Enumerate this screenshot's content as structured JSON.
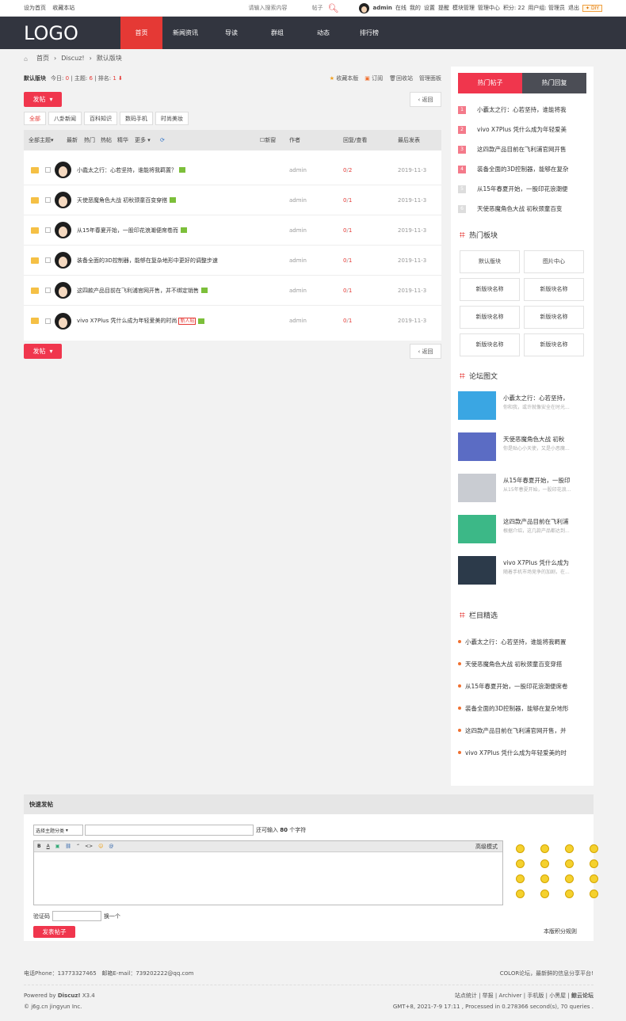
{
  "topbar": {
    "set_home": "设为首页",
    "favorite": "收藏本站",
    "search_placeholder": "请输入搜索内容",
    "search_type": "帖子",
    "user": "admin",
    "links": [
      "在线",
      "我的",
      "设置",
      "提醒",
      "模块管理",
      "管理中心"
    ],
    "points": "积分: 22",
    "group": "用户组: 管理员",
    "logout": "退出",
    "diy": "DIY"
  },
  "nav": {
    "logo": "LOGO",
    "items": [
      "首页",
      "新闻资讯",
      "导读",
      "群组",
      "动态",
      "排行榜"
    ]
  },
  "breadcrumb": [
    "首页",
    "Discuz!",
    "默认版块"
  ],
  "forum": {
    "name": "默认版块",
    "today_label": "今日:",
    "today": "0",
    "topics_label": "主题:",
    "topics": "6",
    "rank_label": "排名:",
    "rank": "1",
    "actions": [
      "收藏本版",
      "订阅",
      "回收站",
      "管理面板"
    ]
  },
  "buttons": {
    "post": "发帖",
    "back": "返回"
  },
  "types": [
    "全部",
    "八卦新闻",
    "百科知识",
    "数码手机",
    "时尚美妆"
  ],
  "thead": {
    "filter": "全部主题",
    "latest": "最新",
    "hot": "热门",
    "hotpost": "热帖",
    "digest": "精华",
    "more": "更多",
    "newwin": "新窗",
    "author": "作者",
    "replies": "回复/查看",
    "lastpost": "最后发表"
  },
  "threads": [
    {
      "title": "小蠹太之行：心若坚持，谁能将我羁置？",
      "author": "admin",
      "reply": "0",
      "view": "2",
      "date": "2019-11-3",
      "new": ""
    },
    {
      "title": "天使恶魔角色大战 初秋颈童百变穿搭",
      "author": "admin",
      "reply": "0",
      "view": "1",
      "date": "2019-11-3",
      "new": ""
    },
    {
      "title": "从15年春夏开始，一股印花浪潮便席卷而",
      "author": "admin",
      "reply": "0",
      "view": "1",
      "date": "2019-11-3",
      "new": ""
    },
    {
      "title": "装备全面的3D控制器，能够在复杂地形中更好的调整步速",
      "author": "admin",
      "reply": "0",
      "view": "1",
      "date": "2019-11-3",
      "new": ""
    },
    {
      "title": "这四款产品目前在飞利浦官网开售，并不绑定销售",
      "author": "admin",
      "reply": "0",
      "view": "1",
      "date": "2019-11-3",
      "new": ""
    },
    {
      "title": "vivo X7Plus 凭什么成为年轻爱美的时尚",
      "author": "admin",
      "reply": "0",
      "view": "1",
      "date": "2019-11-3",
      "new": "新人帖"
    }
  ],
  "side": {
    "tab_hot": "热门帖子",
    "tab_reply": "热门回复",
    "hot": [
      "小蠹太之行：心若坚持，谁能将我",
      "vivo X7Plus 凭什么成为年轻爱美",
      "这四款产品目前在飞利浦官网开售",
      "装备全面的3D控制器，能够在复杂",
      "从15年春夏开始，一股印花浪潮便",
      "天使恶魔角色大战 初秋颈童百变"
    ],
    "hot_nums": [
      "1",
      "2",
      "3",
      "4",
      "5",
      "6"
    ],
    "blocks_title": "热门板块",
    "blocks": [
      "默认版块",
      "图片中心",
      "新版块名称",
      "新版块名称",
      "新版块名称",
      "新版块名称",
      "新版块名称",
      "新版块名称"
    ],
    "pics_title": "论坛图文",
    "pics": [
      {
        "t": "小蠹太之行：心若坚持，",
        "d": "你和我，或许就像安全在时光..."
      },
      {
        "t": "天使恶魔角色大战 初秋",
        "d": "你是贴心小天使，又是小恶魔..."
      },
      {
        "t": "从15年春夏开始，一股印",
        "d": "从15年春夏开始，一股印花浪..."
      },
      {
        "t": "这四款产品目前在飞利浦",
        "d": "根据介绍，这几款产品都达到..."
      },
      {
        "t": "vivo X7Plus 凭什么成为",
        "d": "随着手机市场竞争的加剧，在..."
      }
    ],
    "picks_title": "栏目精选",
    "picks": [
      "小蠹太之行：心若坚持，谁能将我羁置",
      "天使恶魔角色大战 初秋颈童百变穿搭",
      "从15年春夏开始，一股印花浪潮便席卷",
      "装备全面的3D控制器，能够在复杂地形",
      "这四款产品目前在飞利浦官网开售，并",
      "vivo X7Plus 凭什么成为年轻爱美的时"
    ]
  },
  "quick": {
    "title": "快速发帖",
    "category": "选择主题分类",
    "remain": "还可输入",
    "remain_num": "80",
    "remain_unit": "个字符",
    "advanced": "高级模式",
    "captcha": "验证码",
    "change": "换一个",
    "submit": "发表帖子",
    "rules": "本版积分规则"
  },
  "footer": {
    "phone": "电话Phone：13773327465",
    "email": "邮箱E-mail：739202222@qq.com",
    "slogan": "COLOR论坛，最新鲜的信息分享平台!",
    "powered": "Powered by",
    "discuz": "Discuz!",
    "ver": "X3.4",
    "copy": "© j6g.cn jingyun Inc.",
    "links": [
      "站点统计",
      "举报",
      "Archiver",
      "手机版",
      "小黑屋",
      "鲸云论坛"
    ],
    "gmt": "GMT+8, 2021-7-9 17:11 , Processed in 0.278366 second(s), 70 queries ."
  },
  "colors": {
    "accent": "#f0364d",
    "nav": "#32353f",
    "active": "#e53935"
  }
}
